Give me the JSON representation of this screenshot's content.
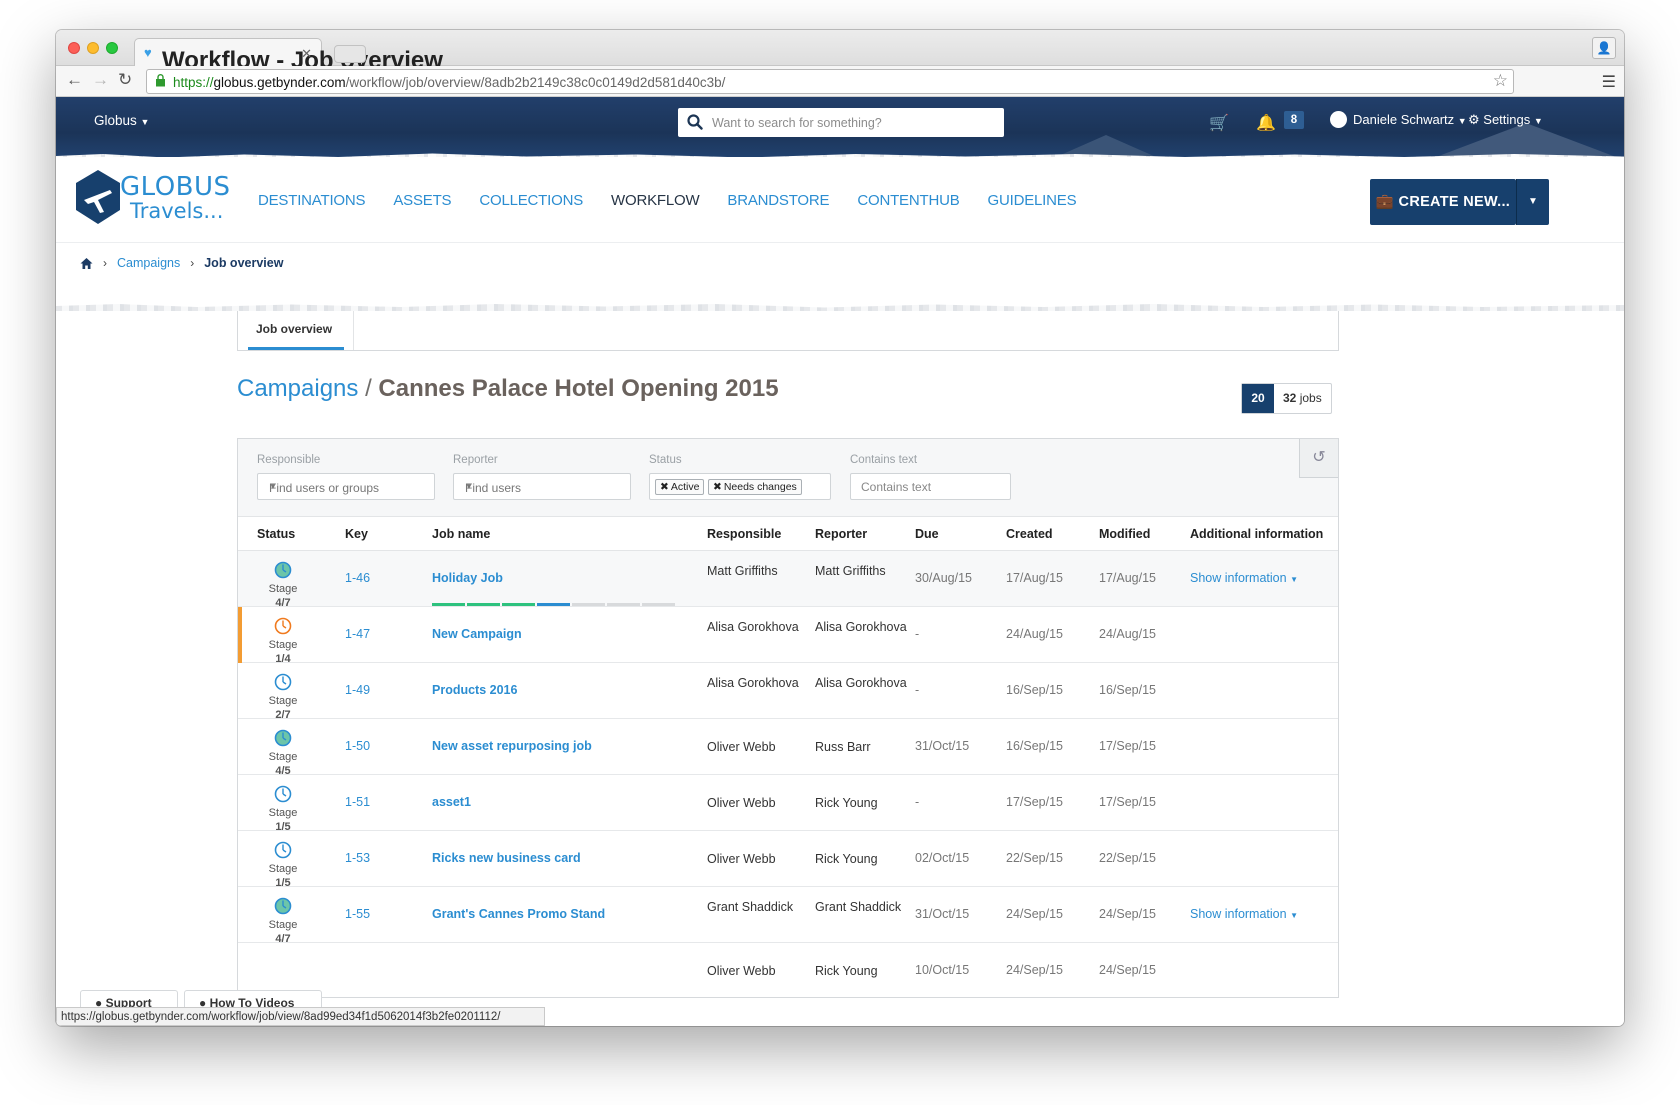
{
  "browser": {
    "tab_title": "Workflow - Job overview",
    "url_scheme": "https://",
    "url_host": "globus.getbynder.com",
    "url_path": "/workflow/job/overview/8adb2b2149c38c0c0149d2d581d40c3b/",
    "status_url": "https://globus.getbynder.com/workflow/job/view/8ad99ed34f1d5062014f3b2fe0201112/"
  },
  "header": {
    "brand_menu": "Globus",
    "search_placeholder": "Want to search for something?",
    "notification_count": "8",
    "user_name": "Daniele Schwartz",
    "settings_label": "Settings"
  },
  "logo": {
    "line1": "GLOBUS",
    "line2": "Travels..."
  },
  "nav": {
    "items": [
      {
        "label": "DESTINATIONS"
      },
      {
        "label": "ASSETS"
      },
      {
        "label": "COLLECTIONS"
      },
      {
        "label": "WORKFLOW"
      },
      {
        "label": "BRANDSTORE"
      },
      {
        "label": "CONTENTHUB"
      },
      {
        "label": "GUIDELINES"
      }
    ],
    "active": "WORKFLOW",
    "create_label": "CREATE NEW..."
  },
  "breadcrumb": {
    "parent": "Campaigns",
    "current": "Job overview"
  },
  "subtab": {
    "label": "Job overview"
  },
  "page": {
    "title_link": "Campaigns",
    "title_sep": "/",
    "title_name": "Cannes Palace Hotel Opening 2015",
    "count_shown": "20",
    "count_total": "32",
    "count_unit": "jobs"
  },
  "filters": {
    "responsible_label": "Responsible",
    "responsible_placeholder": "Find users or groups",
    "reporter_label": "Reporter",
    "reporter_placeholder": "Find users",
    "status_label": "Status",
    "status_tags": [
      "Active",
      "Needs changes"
    ],
    "text_label": "Contains text",
    "text_placeholder": "Contains text"
  },
  "table": {
    "columns": [
      "Status",
      "Key",
      "Job name",
      "Responsible",
      "Reporter",
      "Due",
      "Created",
      "Modified",
      "Additional information"
    ],
    "rows": [
      {
        "stage": "Stage",
        "stage_num": "4/7",
        "key": "1-46",
        "job": "Holiday Job",
        "responsible": "Matt Griffiths",
        "reporter": "Matt Griffiths",
        "due": "30/Aug/15",
        "created": "17/Aug/15",
        "modified": "17/Aug/15",
        "info": "Show information"
      },
      {
        "stage": "Stage",
        "stage_num": "1/4",
        "key": "1-47",
        "job": "New Campaign",
        "responsible": "Alisa Gorokhova",
        "reporter": "Alisa Gorokhova",
        "due": "-",
        "created": "24/Aug/15",
        "modified": "24/Aug/15",
        "info": ""
      },
      {
        "stage": "Stage",
        "stage_num": "2/7",
        "key": "1-49",
        "job": "Products 2016",
        "responsible": "Alisa Gorokhova",
        "reporter": "Alisa Gorokhova",
        "due": "-",
        "created": "16/Sep/15",
        "modified": "16/Sep/15",
        "info": ""
      },
      {
        "stage": "Stage",
        "stage_num": "4/5",
        "key": "1-50",
        "job": "New asset repurposing job",
        "responsible": "Oliver Webb",
        "reporter": "Russ Barr",
        "due": "31/Oct/15",
        "created": "16/Sep/15",
        "modified": "17/Sep/15",
        "info": ""
      },
      {
        "stage": "Stage",
        "stage_num": "1/5",
        "key": "1-51",
        "job": "asset1",
        "responsible": "Oliver Webb",
        "reporter": "Rick Young",
        "due": "-",
        "created": "17/Sep/15",
        "modified": "17/Sep/15",
        "info": ""
      },
      {
        "stage": "Stage",
        "stage_num": "1/5",
        "key": "1-53",
        "job": "Ricks new business card",
        "responsible": "Oliver Webb",
        "reporter": "Rick Young",
        "due": "02/Oct/15",
        "created": "22/Sep/15",
        "modified": "22/Sep/15",
        "info": ""
      },
      {
        "stage": "Stage",
        "stage_num": "4/7",
        "key": "1-55",
        "job": "Grant's Cannes Promo Stand",
        "responsible": "Grant Shaddick",
        "reporter": "Grant Shaddick",
        "due": "31/Oct/15",
        "created": "24/Sep/15",
        "modified": "24/Sep/15",
        "info": "Show information"
      },
      {
        "stage": "",
        "stage_num": "",
        "key": "",
        "job": "",
        "responsible": "Oliver Webb",
        "reporter": "Rick Young",
        "due": "10/Oct/15",
        "created": "24/Sep/15",
        "modified": "24/Sep/15",
        "info": ""
      }
    ],
    "first_row_progress": [
      "done",
      "done",
      "done",
      "current",
      "todo",
      "todo",
      "todo"
    ]
  },
  "colors": {
    "accent": "#2b8dd1",
    "navy": "#17406d",
    "progress_done": "#2ec27e",
    "progress_current": "#2b8dd1",
    "flag_orange": "#f39c33",
    "stage_orange": "#f07a1e"
  }
}
